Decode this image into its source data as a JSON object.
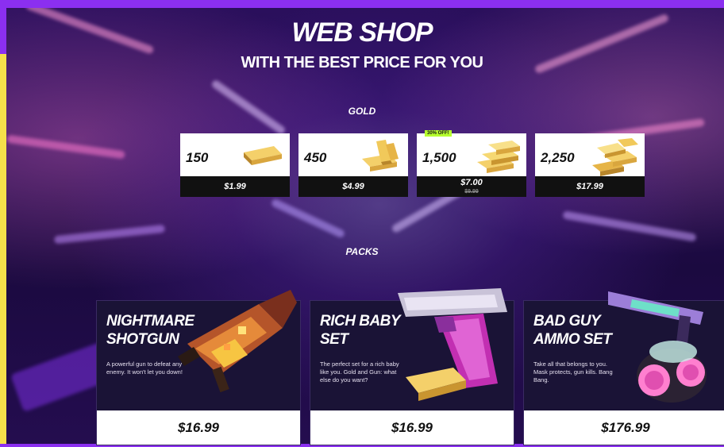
{
  "header": {
    "title": "WEB SHOP",
    "subtitle": "WITH THE BEST PRICE FOR YOU"
  },
  "gold": {
    "section_label": "GOLD",
    "items": [
      {
        "amount": "150",
        "price": "$1.99"
      },
      {
        "amount": "450",
        "price": "$4.99"
      },
      {
        "amount": "1,500",
        "price": "$7.00",
        "old_price": "$9.99",
        "badge": "30% OFF!"
      },
      {
        "amount": "2,250",
        "price": "$17.99"
      }
    ]
  },
  "packs": {
    "section_label": "PACKS",
    "items": [
      {
        "name_line1": "NIGHTMARE",
        "name_line2": "SHOTGUN",
        "description": "A powerful gun to defeat any enemy. It won't let you down!",
        "price": "$16.99"
      },
      {
        "name_line1": "RICH BABY",
        "name_line2": "SET",
        "description": "The perfect set for a rich baby like you. Gold and Gun: what else do you want?",
        "price": "$16.99"
      },
      {
        "name_line1": "BAD GUY",
        "name_line2": "AMMO SET",
        "description": "Take all that belongs to you. Mask protects, gun kills. Bang Bang.",
        "price": "$176.99"
      }
    ]
  },
  "colors": {
    "frame": "#8b2ff0",
    "frame_accent": "#f5e04a",
    "badge": "#b6ff2e",
    "card_dark": "#111111"
  }
}
